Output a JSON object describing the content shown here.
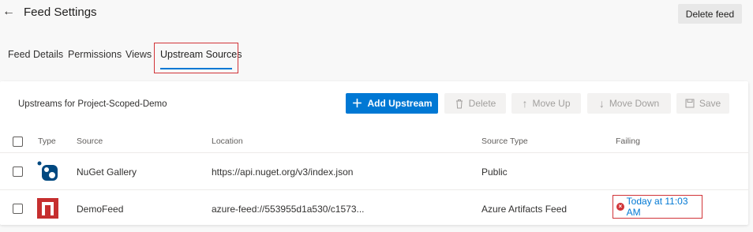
{
  "header": {
    "title": "Feed Settings",
    "delete_feed_label": "Delete feed"
  },
  "tabs": [
    {
      "label": "Feed Details",
      "active": false
    },
    {
      "label": "Permissions",
      "active": false
    },
    {
      "label": "Views",
      "active": false
    },
    {
      "label": "Upstream Sources",
      "active": true
    }
  ],
  "toolbar": {
    "title": "Upstreams for Project-Scoped-Demo",
    "add_upstream_label": "Add Upstream",
    "delete_label": "Delete",
    "move_up_label": "Move Up",
    "move_down_label": "Move Down",
    "save_label": "Save"
  },
  "table": {
    "columns": [
      "Type",
      "Source",
      "Location",
      "Source Type",
      "Failing"
    ],
    "rows": [
      {
        "type_icon": "nuget-icon",
        "source": "NuGet Gallery",
        "location": "https://api.nuget.org/v3/index.json",
        "source_type": "Public",
        "failing": ""
      },
      {
        "type_icon": "azure-artifacts-icon",
        "source": "DemoFeed",
        "location": "azure-feed://553955d1a530/c1573...",
        "source_type": "Azure Artifacts Feed",
        "failing": "Today at 11:03 AM"
      }
    ]
  },
  "colors": {
    "accent": "#0078d4",
    "highlight": "#d13438",
    "azure_artifacts_icon": "#c62f2f",
    "nuget_icon": "#004880"
  }
}
